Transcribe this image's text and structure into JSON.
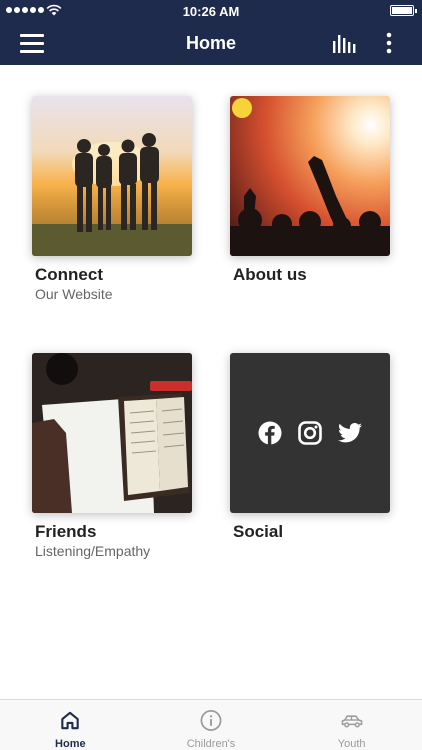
{
  "status_bar": {
    "time": "10:26 AM"
  },
  "nav": {
    "title": "Home",
    "menu_icon": "hamburger-icon",
    "chart_icon": "bars-icon",
    "more_icon": "more-vertical-icon"
  },
  "tiles": [
    {
      "title": "Connect",
      "subtitle": "Our Website"
    },
    {
      "title": "About us",
      "subtitle": ""
    },
    {
      "title": "Friends",
      "subtitle": "Listening/Empathy"
    },
    {
      "title": "Social",
      "subtitle": "",
      "icons": [
        "facebook-icon",
        "instagram-icon",
        "twitter-icon"
      ]
    }
  ],
  "tab_bar": {
    "tabs": [
      {
        "label": "Home",
        "icon": "home-icon",
        "active": true
      },
      {
        "label": "Children's",
        "icon": "info-icon",
        "active": false
      },
      {
        "label": "Youth",
        "icon": "car-icon",
        "active": false
      }
    ]
  },
  "colors": {
    "nav_bg": "#1f2b4d",
    "active_tab": "#1f2b4d",
    "inactive_tab": "#9b9b9b",
    "social_tile": "#333333"
  }
}
